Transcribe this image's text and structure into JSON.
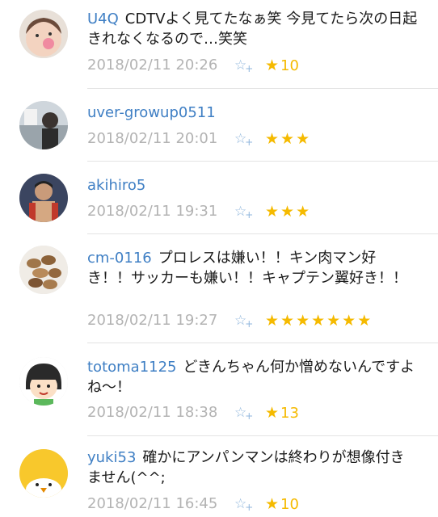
{
  "comments": [
    {
      "user": "U4Q",
      "text": "CDTVよく見てたなぁ笑 今見てたら次の日起きれなくなるので…笑笑",
      "date": "2018/02/11 20:26",
      "stars": "★",
      "count": "10"
    },
    {
      "user": "uver-growup0511",
      "text": "",
      "date": "2018/02/11 20:01",
      "stars": "★★★",
      "count": ""
    },
    {
      "user": "akihiro5",
      "text": "",
      "date": "2018/02/11 19:31",
      "stars": "★★★",
      "count": ""
    },
    {
      "user": "cm-0116",
      "text": "プロレスは嫌い！！キン肉マン好き！！サッカーも嫌い！！キャプテン翼好き！！",
      "date": "2018/02/11 19:27",
      "stars": "★★★★★★★",
      "count": ""
    },
    {
      "user": "totoma1125",
      "text": "どきんちゃん何か憎めないんですよね〜！",
      "date": "2018/02/11 18:38",
      "stars": "★",
      "count": "13"
    },
    {
      "user": "yuki53",
      "text": "確かにアンパンマンは終わりが想像付きません(^^;",
      "date": "2018/02/11 16:45",
      "stars": "★",
      "count": "10"
    }
  ],
  "icons": {
    "rate_button": "add-star-icon",
    "star": "star-icon"
  },
  "colors": {
    "username": "#3f7fc4",
    "date": "#b3b3b3",
    "star": "#f5ba00",
    "rate_button": "#8fb6dc"
  }
}
